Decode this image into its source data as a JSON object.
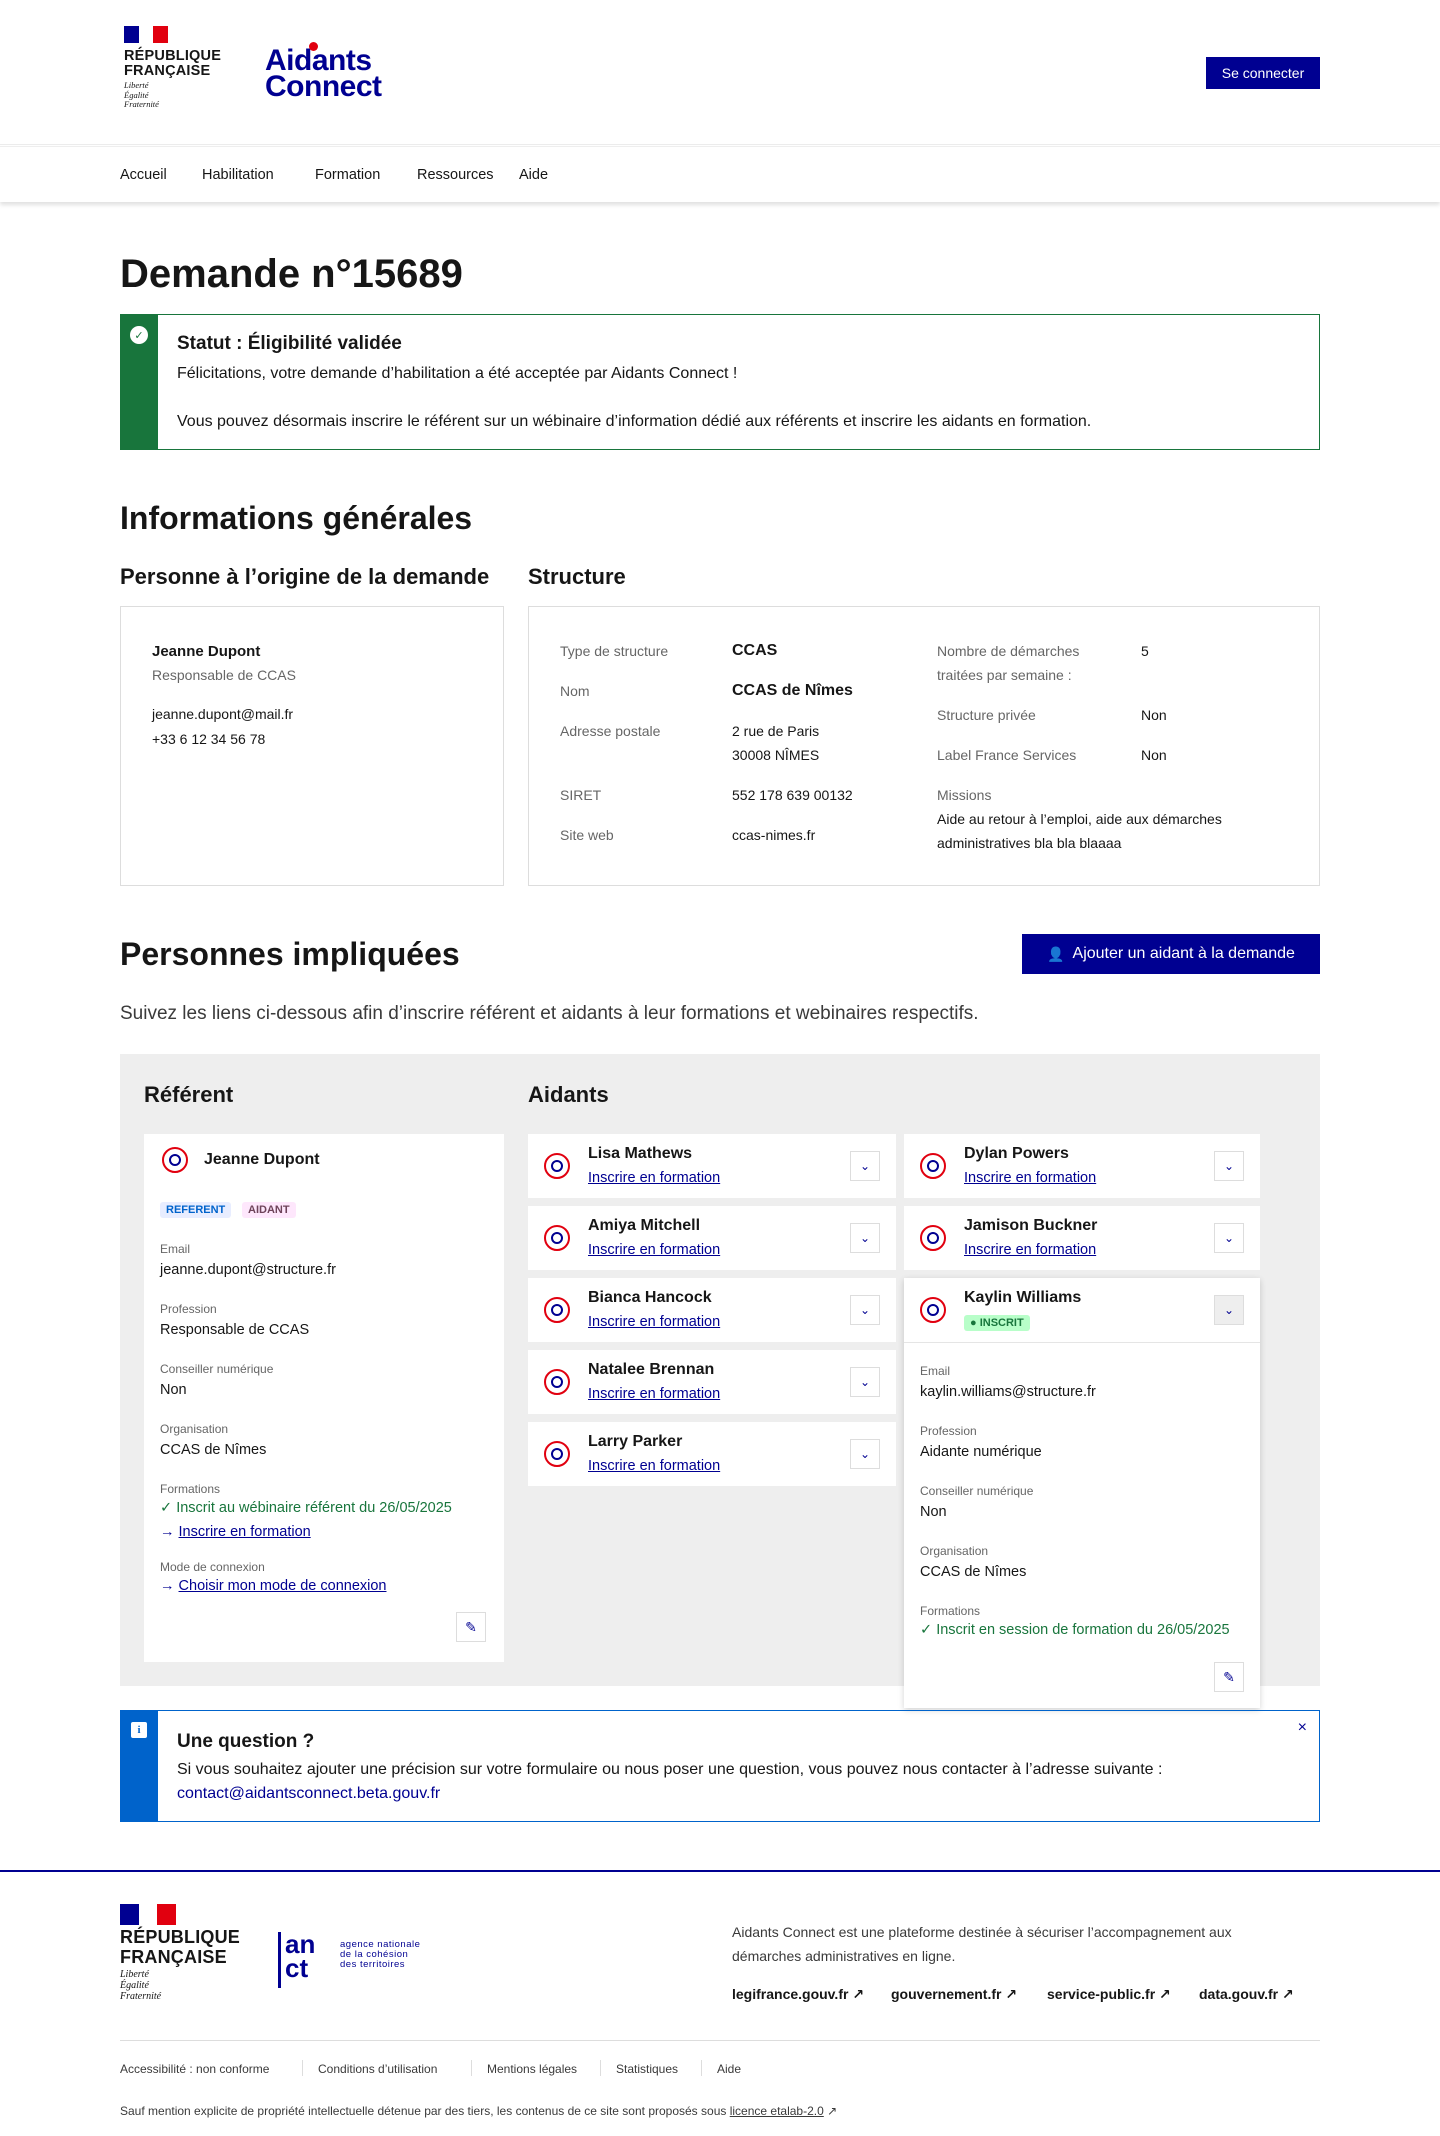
{
  "header": {
    "republic_line1": "RÉPUBLIQUE",
    "republic_line2": "FRANÇAISE",
    "motto": [
      "Liberté",
      "Égalité",
      "Fraternité"
    ],
    "logo_line1": "Aidants",
    "logo_line2": "Connect",
    "login_label": "Se connecter"
  },
  "nav": [
    "Accueil",
    "Habilitation",
    "Formation",
    "Ressources",
    "Aide"
  ],
  "page_title": "Demande n°15689",
  "status_alert": {
    "title": "Statut : Éligibilité validée",
    "line1": "Félicitations, votre demande d’habilitation a été acceptée par Aidants Connect !",
    "line2": "Vous pouvez désormais inscrire le référent sur un wébinaire d’information dédié aux référents et inscrire les aidants en formation.",
    "icon": "check-circle-icon"
  },
  "general": {
    "title": "Informations générales",
    "person_title": "Personne à l’origine de la demande",
    "structure_title": "Structure",
    "person": {
      "name": "Jeanne Dupont",
      "role": "Responsable de CCAS",
      "email": "jeanne.dupont@mail.fr",
      "phone": "+33 6 12 34 56 78"
    },
    "structure": {
      "type_label": "Type de structure",
      "type_value": "CCAS",
      "name_label": "Nom",
      "name_value": "CCAS de Nîmes",
      "address_label": "Adresse postale",
      "address_line1": "2 rue de Paris",
      "address_line2": "30008 NÎMES",
      "siret_label": "SIRET",
      "siret_value": "552 178 639 00132",
      "web_label": "Site web",
      "web_value": "ccas-nimes.fr",
      "demarches_label1": "Nombre de démarches",
      "demarches_label2": "traitées par semaine :",
      "demarches_value": "5",
      "private_label": "Structure privée",
      "private_value": "Non",
      "label_fs_label": "Label France Services",
      "label_fs_value": "Non",
      "missions_label": "Missions",
      "missions_line1": "Aide au retour à l’emploi, aide aux démarches",
      "missions_line2": "administratives bla bla blaaaa"
    }
  },
  "people": {
    "title": "Personnes impliquées",
    "add_button": "Ajouter un aidant à la demande",
    "intro": "Suivez les liens ci-dessous afin d’inscrire référent et aidants à leur formations et webinaires respectifs.",
    "referent_title": "Référent",
    "aidants_title": "Aidants",
    "referent": {
      "name": "Jeanne Dupont",
      "tags": [
        "REFERENT",
        "AIDANT"
      ],
      "email_label": "Email",
      "email": "jeanne.dupont@structure.fr",
      "profession_label": "Profession",
      "profession": "Responsable de CCAS",
      "conseiller_label": "Conseiller numérique",
      "conseiller": "Non",
      "org_label": "Organisation",
      "org": "CCAS de Nîmes",
      "formations_label": "Formations",
      "formation_done": "Inscrit au wébinaire référent du 26/05/2025",
      "formation_link": "Inscrire en formation",
      "connexion_label": "Mode de connexion",
      "connexion_link": "Choisir mon mode de connexion"
    },
    "aidants_left": [
      {
        "name": "Lisa Mathews",
        "link": "Inscrire en formation"
      },
      {
        "name": "Amiya Mitchell",
        "link": "Inscrire en formation"
      },
      {
        "name": "Bianca Hancock",
        "link": "Inscrire en formation"
      },
      {
        "name": "Natalee Brennan",
        "link": "Inscrire en formation"
      },
      {
        "name": "Larry Parker",
        "link": "Inscrire en formation"
      }
    ],
    "aidants_right": [
      {
        "name": "Dylan Powers",
        "link": "Inscrire en formation"
      },
      {
        "name": "Jamison Buckner",
        "link": "Inscrire en formation"
      }
    ],
    "expanded": {
      "name": "Kaylin Williams",
      "badge": "INSCRIT",
      "email_label": "Email",
      "email": "kaylin.williams@structure.fr",
      "profession_label": "Profession",
      "profession": "Aidante numérique",
      "conseiller_label": "Conseiller numérique",
      "conseiller": "Non",
      "org_label": "Organisation",
      "org": "CCAS de Nîmes",
      "formations_label": "Formations",
      "formation_done": "Inscrit en session de formation du 26/05/2025"
    }
  },
  "question": {
    "title": "Une question ?",
    "text": "Si vous souhaitez ajouter une précision sur votre formulaire ou nous poser une question, vous pouvez nous contacter à l’adresse suivante :",
    "email": "contact@aidantsconnect.beta.gouv.fr",
    "close": "×"
  },
  "footer": {
    "anct_line1": "agence nationale",
    "anct_line2": "de la cohésion",
    "anct_line3": "des territoires",
    "description_line1": "Aidants Connect est une plateforme destinée à sécuriser l’accompagnement aux",
    "description_line2": "démarches administratives en ligne.",
    "ext_links": [
      "legifrance.gouv.fr",
      "gouvernement.fr",
      "service-public.fr",
      "data.gouv.fr"
    ],
    "bottom_links": [
      "Accessibilité : non conforme",
      "Conditions d’utilisation",
      "Mentions légales",
      "Statistiques",
      "Aide"
    ],
    "license_text": "Sauf mention explicite de propriété intellectuelle détenue par des tiers, les contenus de ce site sont proposés sous",
    "license_link": "licence etalab-2.0"
  },
  "colors": {
    "primary": "#000091",
    "success": "#18753c",
    "info": "#0063cb",
    "marianne_red": "#e1000f"
  }
}
